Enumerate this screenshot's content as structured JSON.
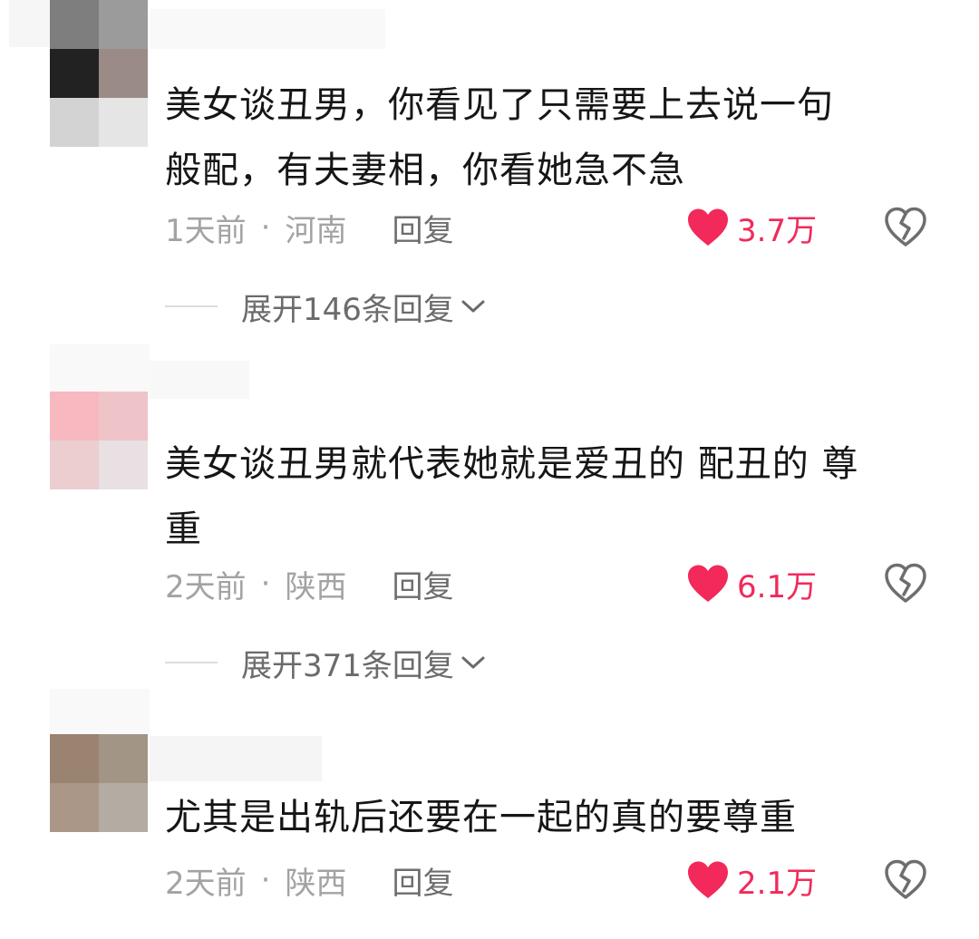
{
  "comments": [
    {
      "avatar_colors": [
        "#7e7e7e",
        "#9b9b9b",
        "#222222",
        "#9a8b86",
        "#d3d3d3",
        "#e5e5e5",
        "#efefef",
        "#f5f5f5"
      ],
      "text_lines": [
        "美女谈丑男，你看见了只需要上去说一句",
        "般配，有夫妻相，你看她急不急"
      ],
      "time": "1天前",
      "separator": "·",
      "location": "河南",
      "reply_label": "回复",
      "likes": "3.7万",
      "expand_label": "展开146条回复"
    },
    {
      "avatar_colors": [
        "#f7b9bf",
        "#efc4c8",
        "#eccdd0",
        "#e8e0e2"
      ],
      "text_lines": [
        "美女谈丑男就代表她就是爱丑的 配丑的 尊",
        "重"
      ],
      "time": "2天前",
      "separator": "·",
      "location": "陕西",
      "reply_label": "回复",
      "likes": "6.1万",
      "expand_label": "展开371条回复"
    },
    {
      "avatar_colors": [
        "#9a8370",
        "#a39585",
        "#aa9787",
        "#b4aca2"
      ],
      "text_lines": [
        "尤其是出轨后还要在一起的真的要尊重"
      ],
      "time": "2天前",
      "separator": "·",
      "location": "陕西",
      "reply_label": "回复",
      "likes": "2.1万"
    }
  ],
  "colors": {
    "like_heart": "#f2295a",
    "text": "#161616",
    "meta": "#a3a3a3"
  },
  "icons": [
    "heart-icon",
    "broken-heart-icon",
    "chevron-down-icon"
  ]
}
